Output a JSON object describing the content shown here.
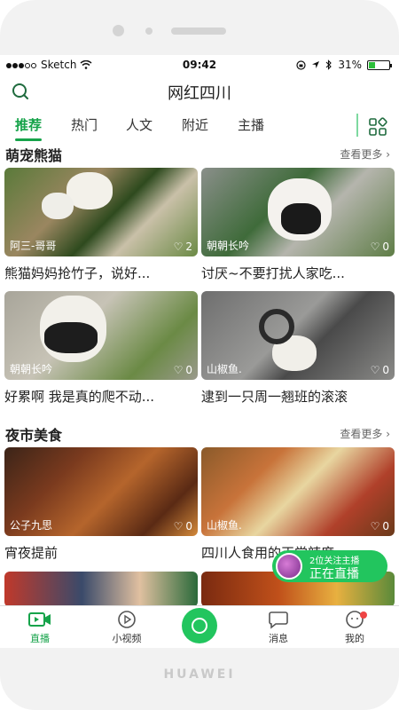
{
  "statusbar": {
    "carrier": "Sketch",
    "time": "09:42",
    "battery": "31%",
    "battery_level": 0.31
  },
  "header": {
    "title": "网红四川"
  },
  "tabs": [
    {
      "label": "推荐",
      "active": true
    },
    {
      "label": "热门",
      "active": false
    },
    {
      "label": "人文",
      "active": false
    },
    {
      "label": "附近",
      "active": false
    },
    {
      "label": "主播",
      "active": false
    }
  ],
  "sections": [
    {
      "title": "萌宠熊猫",
      "more": "查看更多",
      "cards": [
        {
          "author": "阿三-哥哥",
          "likes": "2",
          "caption": "熊猫妈妈抢竹子，说好..."
        },
        {
          "author": "朝朝长吟",
          "likes": "0",
          "caption": "讨厌~不要打扰人家吃..."
        },
        {
          "author": "朝朝长吟",
          "likes": "0",
          "caption": "好累啊 我是真的爬不动..."
        },
        {
          "author": "山椒鱼.",
          "likes": "0",
          "caption": "逮到一只周一翘班的滚滚"
        }
      ]
    },
    {
      "title": "夜市美食",
      "more": "查看更多",
      "cards": [
        {
          "author": "公子九思",
          "likes": "0",
          "caption": "宵夜提前"
        },
        {
          "author": "山椒鱼.",
          "likes": "0",
          "caption": "四川人食用的正常辣度"
        }
      ]
    }
  ],
  "live": {
    "line1": "2位关注主播",
    "line2": "正在直播"
  },
  "bottom_nav": [
    {
      "label": "直播",
      "active": true
    },
    {
      "label": "小视频",
      "active": false
    },
    {
      "label": "消息",
      "active": false
    },
    {
      "label": "我的",
      "active": false
    }
  ],
  "brand": "HUAWEI",
  "colors": {
    "accent": "#16a34a",
    "live": "#22c55e",
    "badge": "#ef4444"
  }
}
